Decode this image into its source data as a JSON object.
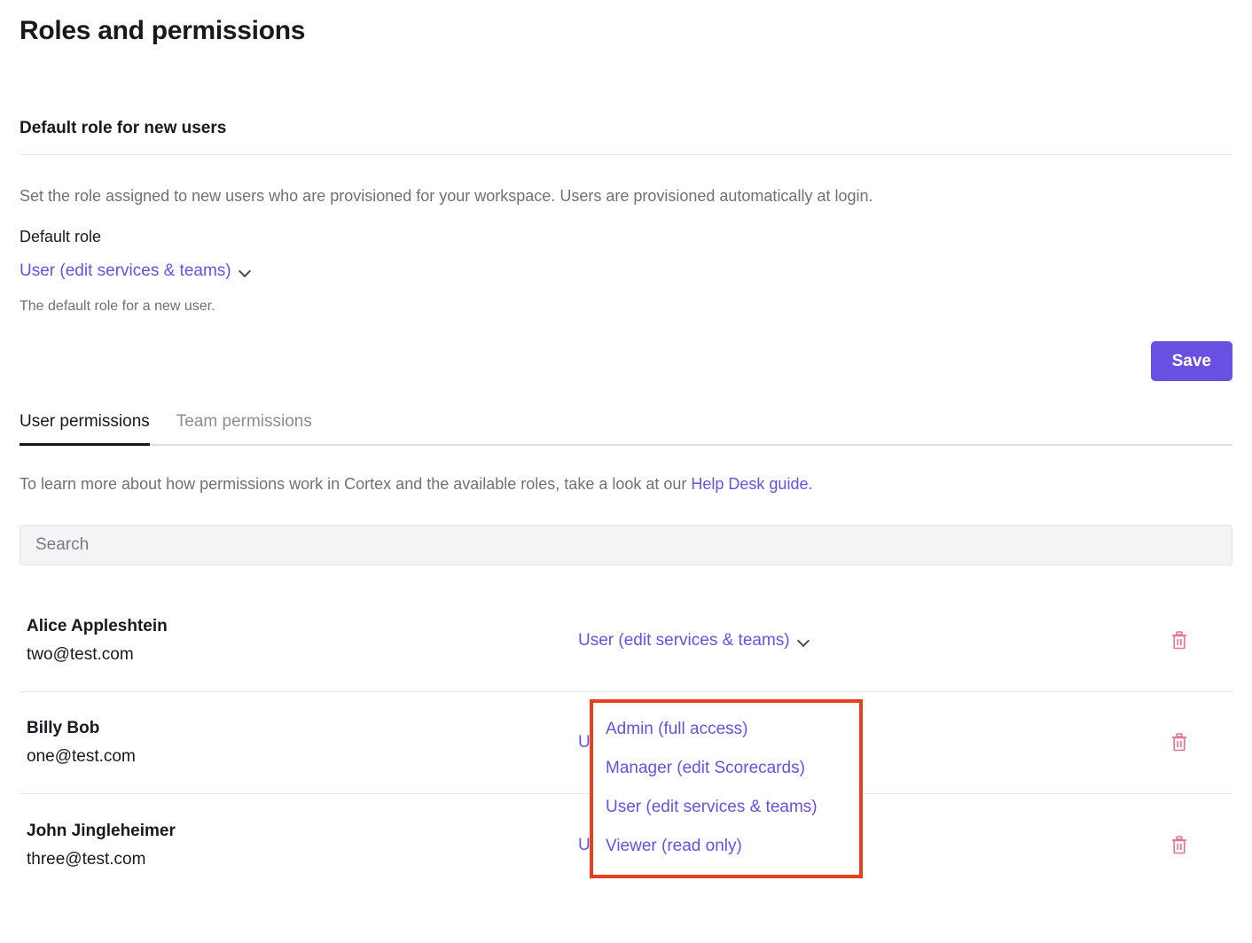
{
  "page": {
    "title": "Roles and permissions"
  },
  "default_role_section": {
    "heading": "Default role for new users",
    "description": "Set the role assigned to new users who are provisioned for your workspace. Users are provisioned automatically at login.",
    "field_label": "Default role",
    "selected_value": "User (edit services & teams)",
    "hint": "The default role for a new user.",
    "save_label": "Save",
    "chevron_icon": "chevron-down-icon"
  },
  "tabs": [
    {
      "label": "User permissions",
      "active": true
    },
    {
      "label": "Team permissions",
      "active": false
    }
  ],
  "help": {
    "text_before": "To learn more about how permissions work in Cortex and the available roles, take a look at our ",
    "link_label": "Help Desk guide."
  },
  "search": {
    "placeholder": "Search",
    "value": ""
  },
  "users": [
    {
      "name": "Alice Appleshtein",
      "email": "two@test.com",
      "role": "User (edit services & teams)",
      "delete_icon": "trash-icon"
    },
    {
      "name": "Billy Bob",
      "email": "one@test.com",
      "role": "User (edit services & teams)",
      "delete_icon": "trash-icon"
    },
    {
      "name": "John Jingleheimer",
      "email": "three@test.com",
      "role": "User (edit services & teams)",
      "delete_icon": "trash-icon"
    }
  ],
  "role_dropdown": {
    "open": true,
    "options": [
      "Admin (full access)",
      "Manager (edit Scorecards)",
      "User (edit services & teams)",
      "Viewer (read only)"
    ]
  },
  "colors": {
    "accent_purple": "#6a50e0",
    "highlight_red": "#e8401f",
    "trash_red": "#e8738a",
    "muted_text": "#6f7178"
  }
}
